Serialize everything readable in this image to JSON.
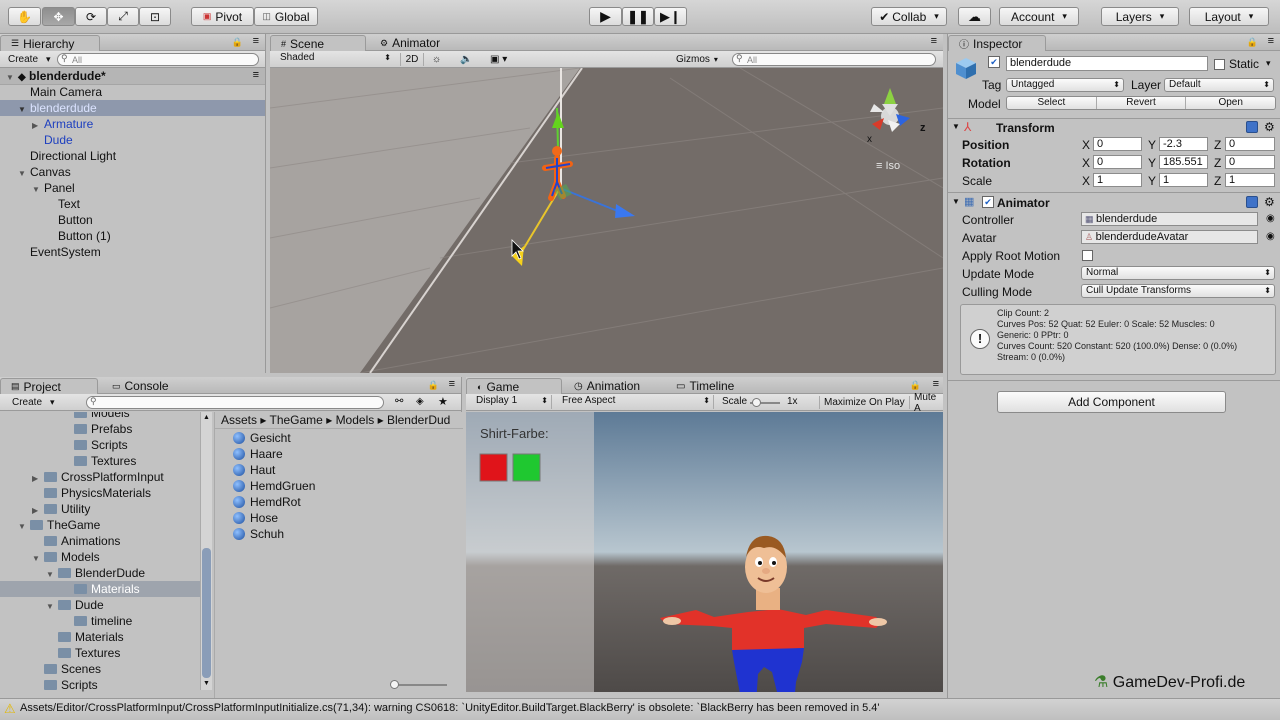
{
  "toolbar": {
    "pivot": "Pivot",
    "global": "Global",
    "collab": "Collab",
    "account": "Account",
    "layers": "Layers",
    "layout": "Layout"
  },
  "hierarchy": {
    "tab": "Hierarchy",
    "create": "Create",
    "search_placeholder": "All",
    "scene": "blenderdude*",
    "items": [
      "Main Camera",
      "blenderdude",
      "Armature",
      "Dude",
      "Directional Light",
      "Canvas",
      "Panel",
      "Text",
      "Button",
      "Button (1)",
      "EventSystem"
    ]
  },
  "scene": {
    "tab": "Scene",
    "animator_tab": "Animator",
    "shading": "Shaded",
    "mode2d": "2D",
    "gizmos": "Gizmos",
    "search_placeholder": "All",
    "persp": "Iso",
    "axis_x": "x",
    "axis_z": "z"
  },
  "inspector": {
    "tab": "Inspector",
    "name": "blenderdude",
    "static": "Static",
    "tag_label": "Tag",
    "tag": "Untagged",
    "layer_label": "Layer",
    "layer": "Default",
    "model_label": "Model",
    "select": "Select",
    "revert": "Revert",
    "open": "Open",
    "transform": {
      "title": "Transform",
      "position": "Position",
      "rotation": "Rotation",
      "scale": "Scale",
      "pos": [
        "0",
        "-2.3",
        "0"
      ],
      "rot": [
        "0",
        "185.551",
        "0"
      ],
      "scl": [
        "1",
        "1",
        "1"
      ]
    },
    "animator": {
      "title": "Animator",
      "controller_label": "Controller",
      "controller": "blenderdude",
      "avatar_label": "Avatar",
      "avatar": "blenderdudeAvatar",
      "root_motion": "Apply Root Motion",
      "update_label": "Update Mode",
      "update": "Normal",
      "culling_label": "Culling Mode",
      "culling": "Cull Update Transforms",
      "info": [
        "Clip Count: 2",
        "Curves Pos: 52 Quat: 52 Euler: 0 Scale: 52 Muscles: 0",
        "Generic: 0 PPtr: 0",
        "Curves Count: 520 Constant: 520 (100.0%) Dense: 0 (0.0%)",
        "Stream: 0 (0.0%)"
      ]
    },
    "add_component": "Add Component"
  },
  "project": {
    "tab": "Project",
    "console_tab": "Console",
    "create": "Create",
    "breadcrumb": [
      "Assets",
      "TheGame",
      "Models",
      "BlenderDud"
    ],
    "tree": [
      "Models",
      "Prefabs",
      "Scripts",
      "Textures",
      "CrossPlatformInput",
      "PhysicsMaterials",
      "Utility",
      "TheGame",
      "Animations",
      "Models",
      "BlenderDude",
      "Materials",
      "Dude",
      "timeline",
      "Materials",
      "Textures",
      "Scenes",
      "Scripts"
    ],
    "files": [
      "Gesicht",
      "Haare",
      "Haut",
      "HemdGruen",
      "HemdRot",
      "Hose",
      "Schuh"
    ]
  },
  "game": {
    "tab": "Game",
    "animation_tab": "Animation",
    "timeline_tab": "Timeline",
    "display": "Display 1",
    "aspect": "Free Aspect",
    "scale_label": "Scale",
    "scale_value": "1x",
    "maximize": "Maximize On Play",
    "mute": "Mute A",
    "ui_label": "Shirt-Farbe:"
  },
  "status": {
    "message": "Assets/Editor/CrossPlatformInput/CrossPlatformInputInitialize.cs(71,34): warning CS0618: `UnityEditor.BuildTarget.BlackBerry' is obsolete: `BlackBerry has been removed in 5.4'"
  },
  "watermark": "GameDev-Profi.de",
  "colors": {
    "red": "#e0141a",
    "green": "#1fc830",
    "selection": "#8e98ac",
    "prefab_blue": "#1d3fbf"
  }
}
